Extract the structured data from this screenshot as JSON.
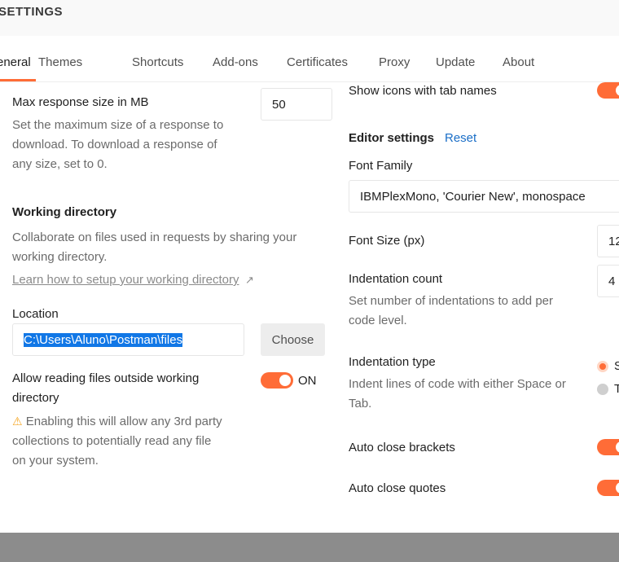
{
  "header": {
    "title": "SETTINGS"
  },
  "tabs": [
    {
      "label": "eneral"
    },
    {
      "label": "Themes"
    },
    {
      "label": "Shortcuts"
    },
    {
      "label": "Add-ons"
    },
    {
      "label": "Certificates"
    },
    {
      "label": "Proxy"
    },
    {
      "label": "Update"
    },
    {
      "label": "About"
    }
  ],
  "left": {
    "max_response": {
      "label": "Max response size in MB",
      "value": "50",
      "desc1": "Set the maximum size of a response to",
      "desc2": "download. To download a response of",
      "desc3": "any size, set to 0."
    },
    "working_dir": {
      "heading": "Working directory",
      "desc1": "Collaborate on files used in requests by sharing your",
      "desc2": "working directory.",
      "learn_link": "Learn how to setup your working directory",
      "learn_arrow": "↗"
    },
    "location": {
      "label": "Location",
      "value": "C:\\Users\\Aluno\\Postman\\files",
      "choose": "Choose"
    },
    "allow_reading": {
      "label1": "Allow reading files outside working",
      "label2": "directory",
      "toggle_state": "ON",
      "warning_icon": "⚠",
      "warn1": " Enabling this will allow any 3rd party",
      "warn2": "collections to potentially read any file",
      "warn3": "on your system."
    }
  },
  "right": {
    "show_icons": {
      "label": "Show icons with tab names"
    },
    "editor": {
      "heading": "Editor settings",
      "reset": "Reset"
    },
    "font_family": {
      "label": "Font Family",
      "value": "IBMPlexMono, 'Courier New', monospace"
    },
    "font_size": {
      "label": "Font Size (px)",
      "value": "12"
    },
    "indent_count": {
      "label": "Indentation count",
      "value": "4",
      "desc1": "Set number of indentations to add per",
      "desc2": "code level."
    },
    "indent_type": {
      "label": "Indentation type",
      "desc1": "Indent lines of code with either Space or",
      "desc2": "Tab.",
      "options": [
        "S",
        "T"
      ]
    },
    "auto_brackets": {
      "label": "Auto close brackets"
    },
    "auto_quotes": {
      "label": "Auto close quotes"
    }
  },
  "colors": {
    "accent": "#ff6c37",
    "link": "#1a6ec7",
    "selection": "#1177e6"
  }
}
